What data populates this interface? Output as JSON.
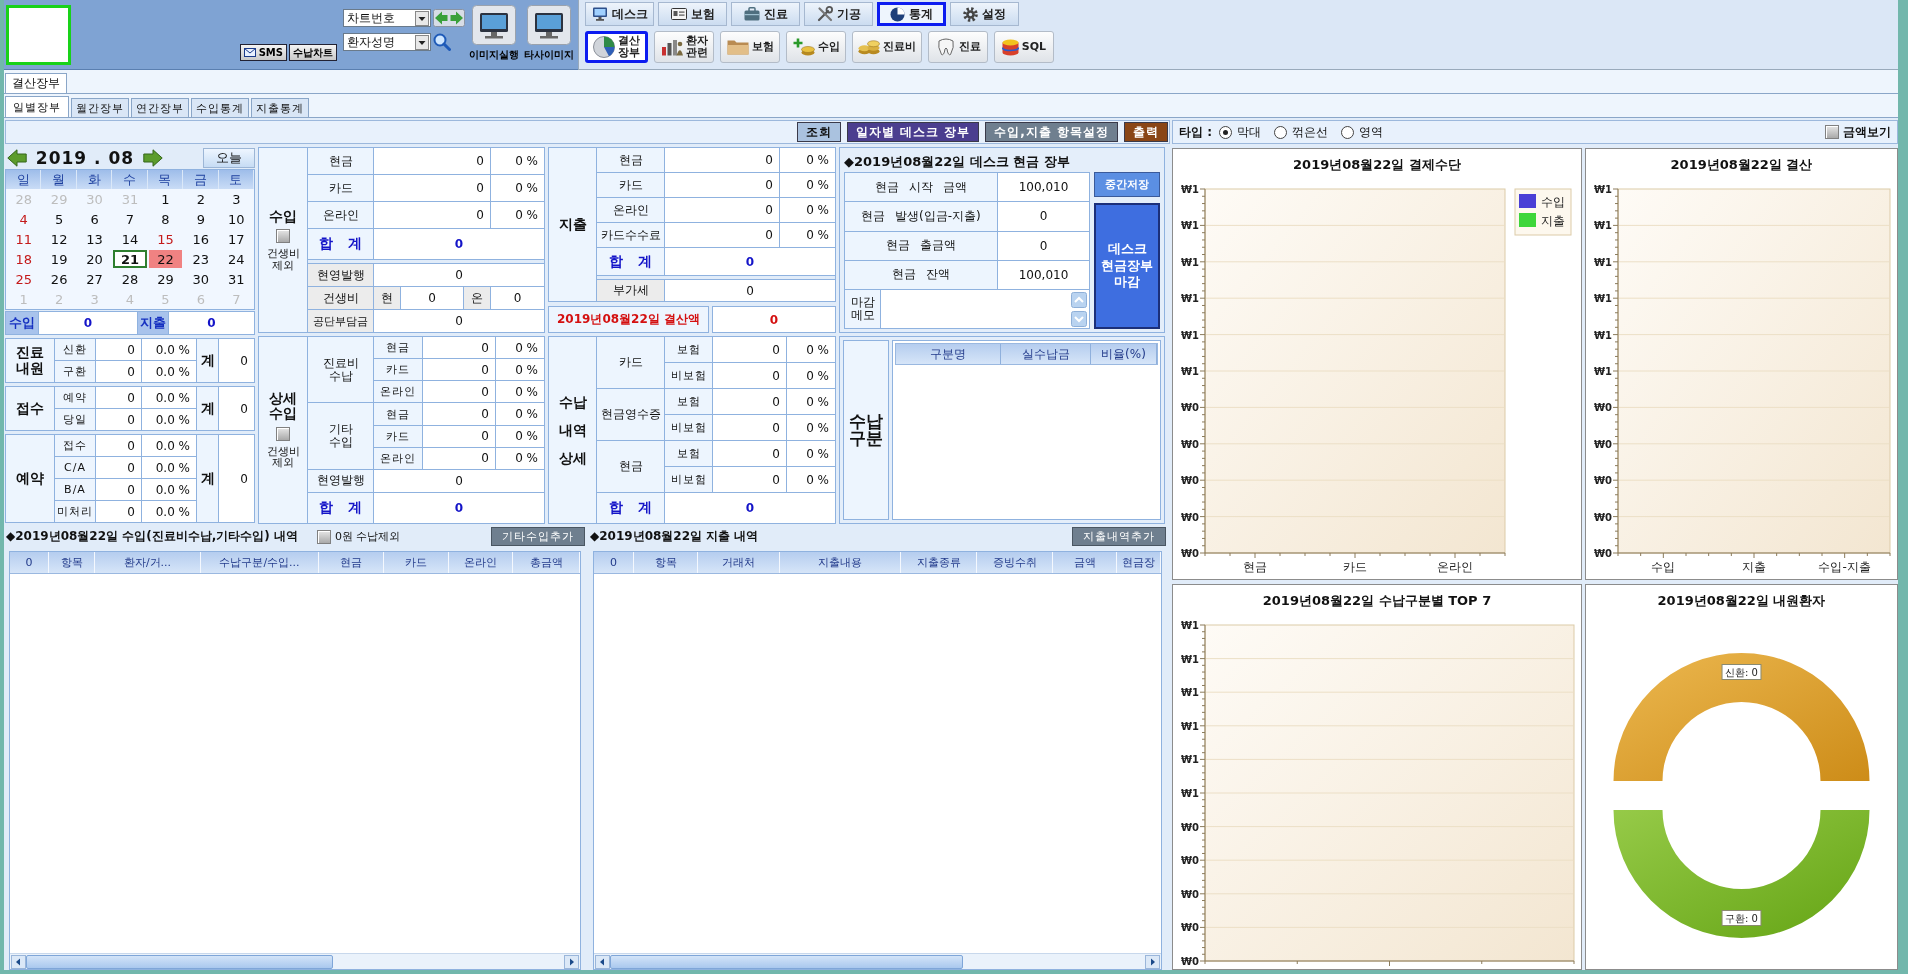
{
  "header": {
    "sms_button": "SMS",
    "chart_button": "수납차트",
    "chart_number_select": {
      "value": "차트번호"
    },
    "patient_name_select": {
      "value": "환자성명"
    },
    "image_buttons": [
      "이미지실행",
      "타사이미지"
    ]
  },
  "module_tabs": [
    {
      "label": "데스크",
      "selected": false
    },
    {
      "label": "보험",
      "selected": false
    },
    {
      "label": "진료",
      "selected": false
    },
    {
      "label": "기공",
      "selected": false
    },
    {
      "label": "통계",
      "selected": true
    },
    {
      "label": "설정",
      "selected": false
    }
  ],
  "toolbar": [
    {
      "label": "결산\n장부",
      "selected": true
    },
    {
      "label": "환자\n관련",
      "selected": false
    },
    {
      "label": "보험",
      "selected": false
    },
    {
      "label": "수입",
      "selected": false
    },
    {
      "label": "진료비",
      "selected": false
    },
    {
      "label": "진료",
      "selected": false
    },
    {
      "label": "SQL",
      "selected": false
    }
  ],
  "document_tabs": [
    {
      "label": "결산장부",
      "selected": true
    }
  ],
  "view_tabs": [
    {
      "label": "일별장부",
      "selected": true
    },
    {
      "label": "월간장부",
      "selected": false
    },
    {
      "label": "연간장부",
      "selected": false
    },
    {
      "label": "수입통계",
      "selected": false
    },
    {
      "label": "지출통계",
      "selected": false
    }
  ],
  "actions": [
    "조회",
    "일자별 데스크 장부",
    "수입,지출 항목설정",
    "출력"
  ],
  "chart_options": {
    "label": "타입 :",
    "types": [
      {
        "label": "막대",
        "selected": true
      },
      {
        "label": "꺾은선",
        "selected": false
      },
      {
        "label": "영역",
        "selected": false
      }
    ],
    "show_amount": {
      "label": "금액보기",
      "checked": false
    }
  },
  "calendar": {
    "month": "2019 . 08",
    "today_button": "오늘",
    "weekdays": [
      "일",
      "월",
      "화",
      "수",
      "목",
      "금",
      "토"
    ],
    "days": [
      {
        "day": "28",
        "kind": "outside",
        "selected": false,
        "today": false
      },
      {
        "day": "29",
        "kind": "outside",
        "selected": false,
        "today": false
      },
      {
        "day": "30",
        "kind": "outside",
        "selected": false,
        "today": false
      },
      {
        "day": "31",
        "kind": "outside",
        "selected": false,
        "today": false
      },
      {
        "day": "1",
        "kind": "weekday",
        "selected": false,
        "today": false
      },
      {
        "day": "2",
        "kind": "weekday",
        "selected": false,
        "today": false
      },
      {
        "day": "3",
        "kind": "weekday",
        "selected": false,
        "today": false
      },
      {
        "day": "4",
        "kind": "holiday",
        "selected": false,
        "today": false
      },
      {
        "day": "5",
        "kind": "weekday",
        "selected": false,
        "today": false
      },
      {
        "day": "6",
        "kind": "weekday",
        "selected": false,
        "today": false
      },
      {
        "day": "7",
        "kind": "weekday",
        "selected": false,
        "today": false
      },
      {
        "day": "8",
        "kind": "weekday",
        "selected": false,
        "today": false
      },
      {
        "day": "9",
        "kind": "weekday",
        "selected": false,
        "today": false
      },
      {
        "day": "10",
        "kind": "weekday",
        "selected": false,
        "today": false
      },
      {
        "day": "11",
        "kind": "holiday",
        "selected": false,
        "today": false
      },
      {
        "day": "12",
        "kind": "weekday",
        "selected": false,
        "today": false
      },
      {
        "day": "13",
        "kind": "weekday",
        "selected": false,
        "today": false
      },
      {
        "day": "14",
        "kind": "weekday",
        "selected": false,
        "today": false
      },
      {
        "day": "15",
        "kind": "holiday",
        "selected": false,
        "today": false
      },
      {
        "day": "16",
        "kind": "weekday",
        "selected": false,
        "today": false
      },
      {
        "day": "17",
        "kind": "weekday",
        "selected": false,
        "today": false
      },
      {
        "day": "18",
        "kind": "holiday",
        "selected": false,
        "today": false
      },
      {
        "day": "19",
        "kind": "weekday",
        "selected": false,
        "today": false
      },
      {
        "day": "20",
        "kind": "weekday",
        "selected": false,
        "today": false
      },
      {
        "day": "21",
        "kind": "weekday",
        "selected": false,
        "today": true
      },
      {
        "day": "22",
        "kind": "weekday",
        "selected": true,
        "today": false
      },
      {
        "day": "23",
        "kind": "weekday",
        "selected": false,
        "today": false
      },
      {
        "day": "24",
        "kind": "weekday",
        "selected": false,
        "today": false
      },
      {
        "day": "25",
        "kind": "holiday",
        "selected": false,
        "today": false
      },
      {
        "day": "26",
        "kind": "weekday",
        "selected": false,
        "today": false
      },
      {
        "day": "27",
        "kind": "weekday",
        "selected": false,
        "today": false
      },
      {
        "day": "28",
        "kind": "weekday",
        "selected": false,
        "today": false
      },
      {
        "day": "29",
        "kind": "weekday",
        "selected": false,
        "today": false
      },
      {
        "day": "30",
        "kind": "weekday",
        "selected": false,
        "today": false
      },
      {
        "day": "31",
        "kind": "weekday",
        "selected": false,
        "today": false
      },
      {
        "day": "1",
        "kind": "outside",
        "selected": false,
        "today": false
      },
      {
        "day": "2",
        "kind": "outside",
        "selected": false,
        "today": false
      },
      {
        "day": "3",
        "kind": "outside",
        "selected": false,
        "today": false
      },
      {
        "day": "4",
        "kind": "outside",
        "selected": false,
        "today": false
      },
      {
        "day": "5",
        "kind": "outside",
        "selected": false,
        "today": false
      },
      {
        "day": "6",
        "kind": "outside",
        "selected": false,
        "today": false
      },
      {
        "day": "7",
        "kind": "outside",
        "selected": false,
        "today": false
      }
    ]
  },
  "calendar_totals": [
    {
      "label": "수입",
      "value": "0"
    },
    {
      "label": "지출",
      "value": "0"
    }
  ],
  "visit_stats": [
    {
      "title": "진료\n내원",
      "rows": [
        {
          "label": "신환",
          "count": "0",
          "percent": "0.0 %"
        },
        {
          "label": "구환",
          "count": "0",
          "percent": "0.0 %"
        }
      ],
      "total_label": "계",
      "total": "0"
    },
    {
      "title": "접수",
      "rows": [
        {
          "label": "예약",
          "count": "0",
          "percent": "0.0 %"
        },
        {
          "label": "당일",
          "count": "0",
          "percent": "0.0 %"
        }
      ],
      "total_label": "계",
      "total": "0"
    },
    {
      "title": "예약",
      "rows": [
        {
          "label": "접수",
          "count": "0",
          "percent": "0.0 %"
        },
        {
          "label": "C/A",
          "count": "0",
          "percent": "0.0 %"
        },
        {
          "label": "B/A",
          "count": "0",
          "percent": "0.0 %"
        },
        {
          "label": "미처리",
          "count": "0",
          "percent": "0.0 %"
        }
      ],
      "total_label": "계",
      "total": "0"
    }
  ],
  "income": {
    "title": "수입",
    "exclude_check": {
      "label": "건생비\n제외",
      "checked": false
    },
    "rows": [
      {
        "label": "현금",
        "amount": "0",
        "percent": "0 %"
      },
      {
        "label": "카드",
        "amount": "0",
        "percent": "0 %"
      },
      {
        "label": "온라인",
        "amount": "0",
        "percent": "0 %"
      }
    ],
    "total": {
      "label": "합 계",
      "amount": "0"
    },
    "cash_receipt": {
      "label": "현영발행",
      "amount": "0"
    },
    "health_fee": {
      "label": "건생비",
      "cash_label": "현",
      "cash": "0",
      "online_label": "온",
      "online": "0"
    },
    "insurer_share": {
      "label": "공단부담금",
      "amount": "0"
    }
  },
  "expense": {
    "title": "지출",
    "rows": [
      {
        "label": "현금",
        "amount": "0",
        "percent": "0 %"
      },
      {
        "label": "카드",
        "amount": "0",
        "percent": "0 %"
      },
      {
        "label": "온라인",
        "amount": "0",
        "percent": "0 %"
      },
      {
        "label": "카드수수료",
        "amount": "0",
        "percent": "0 %"
      }
    ],
    "total": {
      "label": "합 계",
      "amount": "0"
    },
    "vat": {
      "label": "부가세",
      "amount": "0"
    }
  },
  "settlement": {
    "label": "2019년08월22일 결산액",
    "amount": "0"
  },
  "desk_cash": {
    "title": "◆2019년08월22일 데스크 현금 장부",
    "rows": [
      {
        "label": "현금 시작 금액",
        "amount": "100,010"
      },
      {
        "label": "현금 발생(입금-지출)",
        "amount": "0"
      },
      {
        "label": "현금 출금액",
        "amount": "0"
      },
      {
        "label": "현금 잔액",
        "amount": "100,010"
      }
    ],
    "memo": {
      "label": "마감\n메모"
    },
    "save_button": "중간저장",
    "close_button": "데스크\n현금장부\n마감"
  },
  "income_detail": {
    "title": "상세\n수입",
    "exclude_check": {
      "label": "건생비\n제외",
      "checked": false
    },
    "groups": [
      {
        "label": "진료비\n수납",
        "rows": [
          {
            "label": "현금",
            "amount": "0",
            "percent": "0 %"
          },
          {
            "label": "카드",
            "amount": "0",
            "percent": "0 %"
          },
          {
            "label": "온라인",
            "amount": "0",
            "percent": "0 %"
          }
        ]
      },
      {
        "label": "기타\n수입",
        "rows": [
          {
            "label": "현금",
            "amount": "0",
            "percent": "0 %"
          },
          {
            "label": "카드",
            "amount": "0",
            "percent": "0 %"
          },
          {
            "label": "온라인",
            "amount": "0",
            "percent": "0 %"
          }
        ]
      }
    ],
    "cash_receipt": {
      "label": "현영발행",
      "amount": "0"
    },
    "total": {
      "label": "합 계",
      "amount": "0"
    }
  },
  "payment_detail": {
    "title": "수납\n내역\n상세",
    "groups": [
      {
        "label": "카드",
        "rows": [
          {
            "label": "보험",
            "amount": "0",
            "percent": "0 %"
          },
          {
            "label": "비보험",
            "amount": "0",
            "percent": "0 %"
          }
        ]
      },
      {
        "label": "현금영수증",
        "rows": [
          {
            "label": "보험",
            "amount": "0",
            "percent": "0 %"
          },
          {
            "label": "비보험",
            "amount": "0",
            "percent": "0 %"
          }
        ]
      },
      {
        "label": "현금",
        "rows": [
          {
            "label": "보험",
            "amount": "0",
            "percent": "0 %"
          },
          {
            "label": "비보험",
            "amount": "0",
            "percent": "0 %"
          }
        ]
      }
    ],
    "total": {
      "label": "합 계",
      "amount": "0"
    }
  },
  "payment_types": {
    "title": "수납\n구분",
    "columns": [
      "구분명",
      "실수납금",
      "비율(%)"
    ]
  },
  "income_list": {
    "title": "◆2019년08월22일 수입(진료비수납,기타수입) 내역",
    "exclude_zero": {
      "label": "0원 수납제외",
      "checked": false
    },
    "add_button": "기타수입추가",
    "columns": [
      "0",
      "항목",
      "환자/거...",
      "수납구분/수입...",
      "현금",
      "카드",
      "온라인",
      "총금액"
    ]
  },
  "expense_list": {
    "title": "◆2019년08월22일 지출 내역",
    "add_button": "지출내역추가",
    "columns": [
      "0",
      "항목",
      "거래처",
      "지출내용",
      "지출종류",
      "증빙수취",
      "금액",
      "현금장"
    ]
  },
  "charts": [
    {
      "chart_data": {
        "type": "bar",
        "title": "2019년08월22일 결제수단",
        "categories": [
          "현금",
          "카드",
          "온라인"
        ],
        "series": [
          {
            "name": "수입",
            "color": "#4a3fd6",
            "values": [
              0,
              0,
              0
            ]
          },
          {
            "name": "지출",
            "color": "#3ed63a",
            "values": [
              0,
              0,
              0
            ]
          }
        ],
        "ylim": [
          0,
          1
        ],
        "grid": true,
        "yticks": [
          {
            "value": 1,
            "label": "₩1"
          },
          {
            "value": 0.9,
            "label": "₩1"
          },
          {
            "value": 0.8,
            "label": "₩1"
          },
          {
            "value": 0.7,
            "label": "₩1"
          },
          {
            "value": 0.6,
            "label": "₩1"
          },
          {
            "value": 0.5,
            "label": "₩1"
          },
          {
            "value": 0.4,
            "label": "₩0"
          },
          {
            "value": 0.3,
            "label": "₩0"
          },
          {
            "value": 0.2,
            "label": "₩0"
          },
          {
            "value": 0.1,
            "label": "₩0"
          },
          {
            "value": 0,
            "label": "₩0"
          }
        ]
      }
    },
    {
      "chart_data": {
        "type": "bar",
        "title": "2019년08월22일 결산",
        "categories": [
          "수입",
          "지출",
          "수입-지출"
        ],
        "series": [
          {
            "values": [
              0,
              0,
              0
            ]
          }
        ],
        "ylim": [
          0,
          1
        ],
        "grid": true,
        "yticks": [
          {
            "value": 1,
            "label": "₩1"
          },
          {
            "value": 0.9,
            "label": "₩1"
          },
          {
            "value": 0.8,
            "label": "₩1"
          },
          {
            "value": 0.7,
            "label": "₩1"
          },
          {
            "value": 0.6,
            "label": "₩1"
          },
          {
            "value": 0.5,
            "label": "₩1"
          },
          {
            "value": 0.4,
            "label": "₩0"
          },
          {
            "value": 0.3,
            "label": "₩0"
          },
          {
            "value": 0.2,
            "label": "₩0"
          },
          {
            "value": 0.1,
            "label": "₩0"
          },
          {
            "value": 0,
            "label": "₩0"
          }
        ]
      }
    },
    {
      "title": "2019년08월22일 수납구분별 TOP 7",
      "axis_labels": [
        "₩1",
        "₩1",
        "₩1",
        "₩1",
        "₩1",
        "₩1",
        "₩0",
        "₩0",
        "₩0",
        "₩0",
        "₩0"
      ]
    },
    {
      "title": "2019년08월22일 내원환자",
      "slice_labels": [
        "신환: 0",
        "구환: 0"
      ]
    }
  ]
}
